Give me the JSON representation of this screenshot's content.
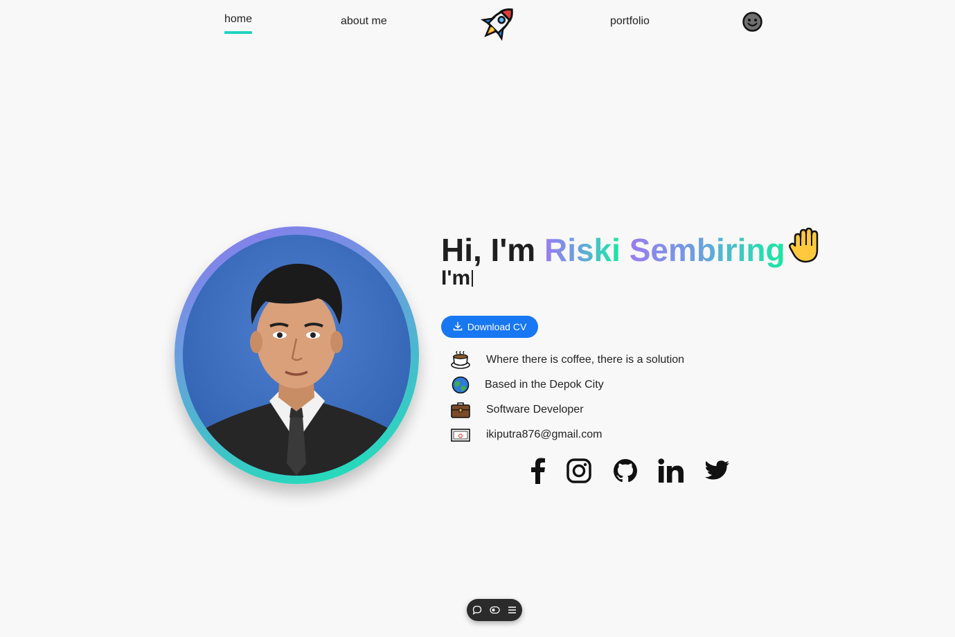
{
  "nav": {
    "home": "home",
    "about": "about me",
    "portfolio": "portfolio",
    "logo_icon": "rocket-icon",
    "theme_icon": "smiley-theme-toggle-icon",
    "active_color": "#22d3c0"
  },
  "hero": {
    "greeting": "Hi, I'm ",
    "first_name": "Riski",
    "last_name": "Sembiring",
    "typed_text": "I'm",
    "wave_icon": "waving-hand-icon",
    "gradient_colors": [
      "#9a7cf0",
      "#19e6a0"
    ]
  },
  "download": {
    "label": "Download CV",
    "icon": "download-icon",
    "color": "#1877f2"
  },
  "info": [
    {
      "icon": "coffee-icon",
      "text": "Where there is coffee, there is a solution"
    },
    {
      "icon": "globe-icon",
      "text": "Based in the Depok City"
    },
    {
      "icon": "briefcase-icon",
      "text": "Software Developer"
    },
    {
      "icon": "envelope-icon",
      "text": "ikiputra876@gmail.com"
    }
  ],
  "socials": [
    "facebook-icon",
    "instagram-icon",
    "github-icon",
    "linkedin-icon",
    "twitter-icon"
  ],
  "toolbar": [
    "comment-icon",
    "toggle-icon",
    "menu-icon"
  ]
}
